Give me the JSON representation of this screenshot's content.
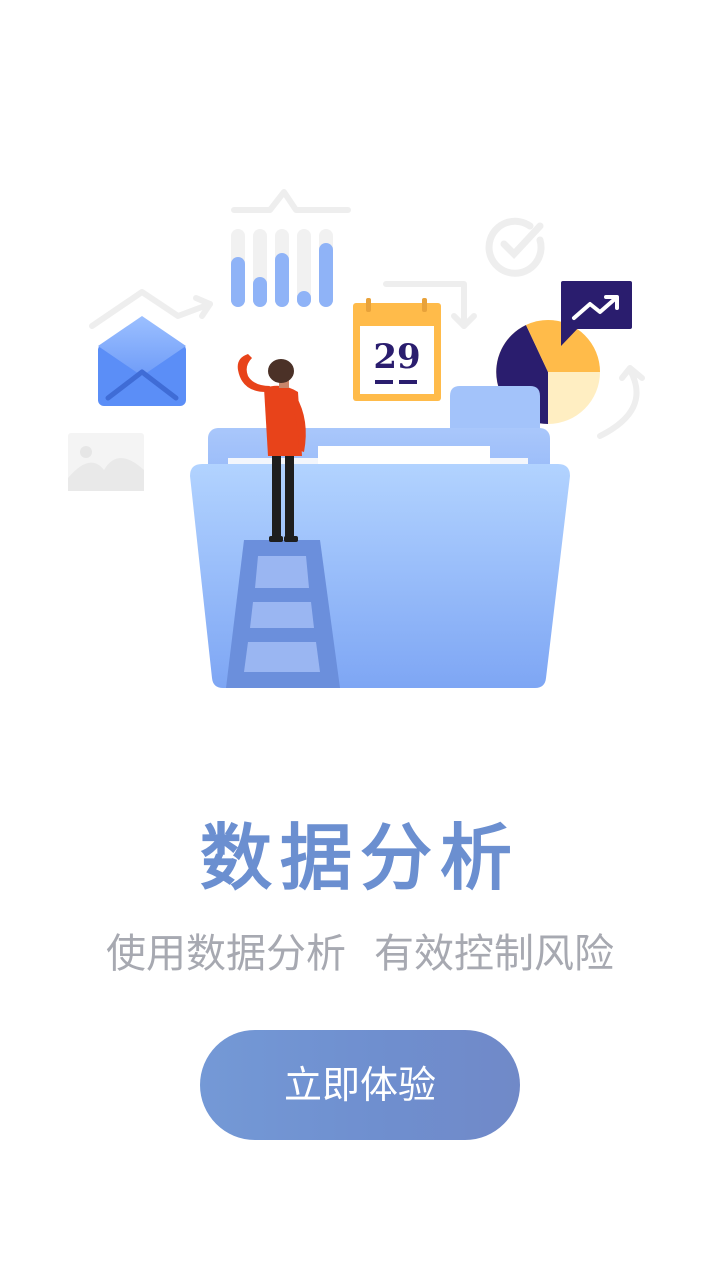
{
  "illustration": {
    "calendar_day": "29",
    "icons": [
      "envelope-icon",
      "bar-chart-icon",
      "check-circle-icon",
      "calendar-icon",
      "pie-chart-icon",
      "trend-up-icon",
      "image-icon",
      "folder-icon",
      "ladder-icon",
      "person-icon"
    ],
    "colors": {
      "folder": "#8fb3f7",
      "envelope": "#5b8ef7",
      "bars": "#8fb3f7",
      "calendar": "#ffbb4a",
      "pie_dark": "#2a1d6e",
      "pie_yellow": "#ffbb4a",
      "pie_light": "#ffeec2",
      "person_shirt": "#e8431a"
    }
  },
  "title": "数据分析",
  "subtitle": {
    "part1": "使用数据分析",
    "part2": "有效控制风险"
  },
  "cta_label": "立即体验",
  "colors": {
    "title": "#6b8fd0",
    "subtitle": "#a7a9b1",
    "button": "#7093d1"
  }
}
